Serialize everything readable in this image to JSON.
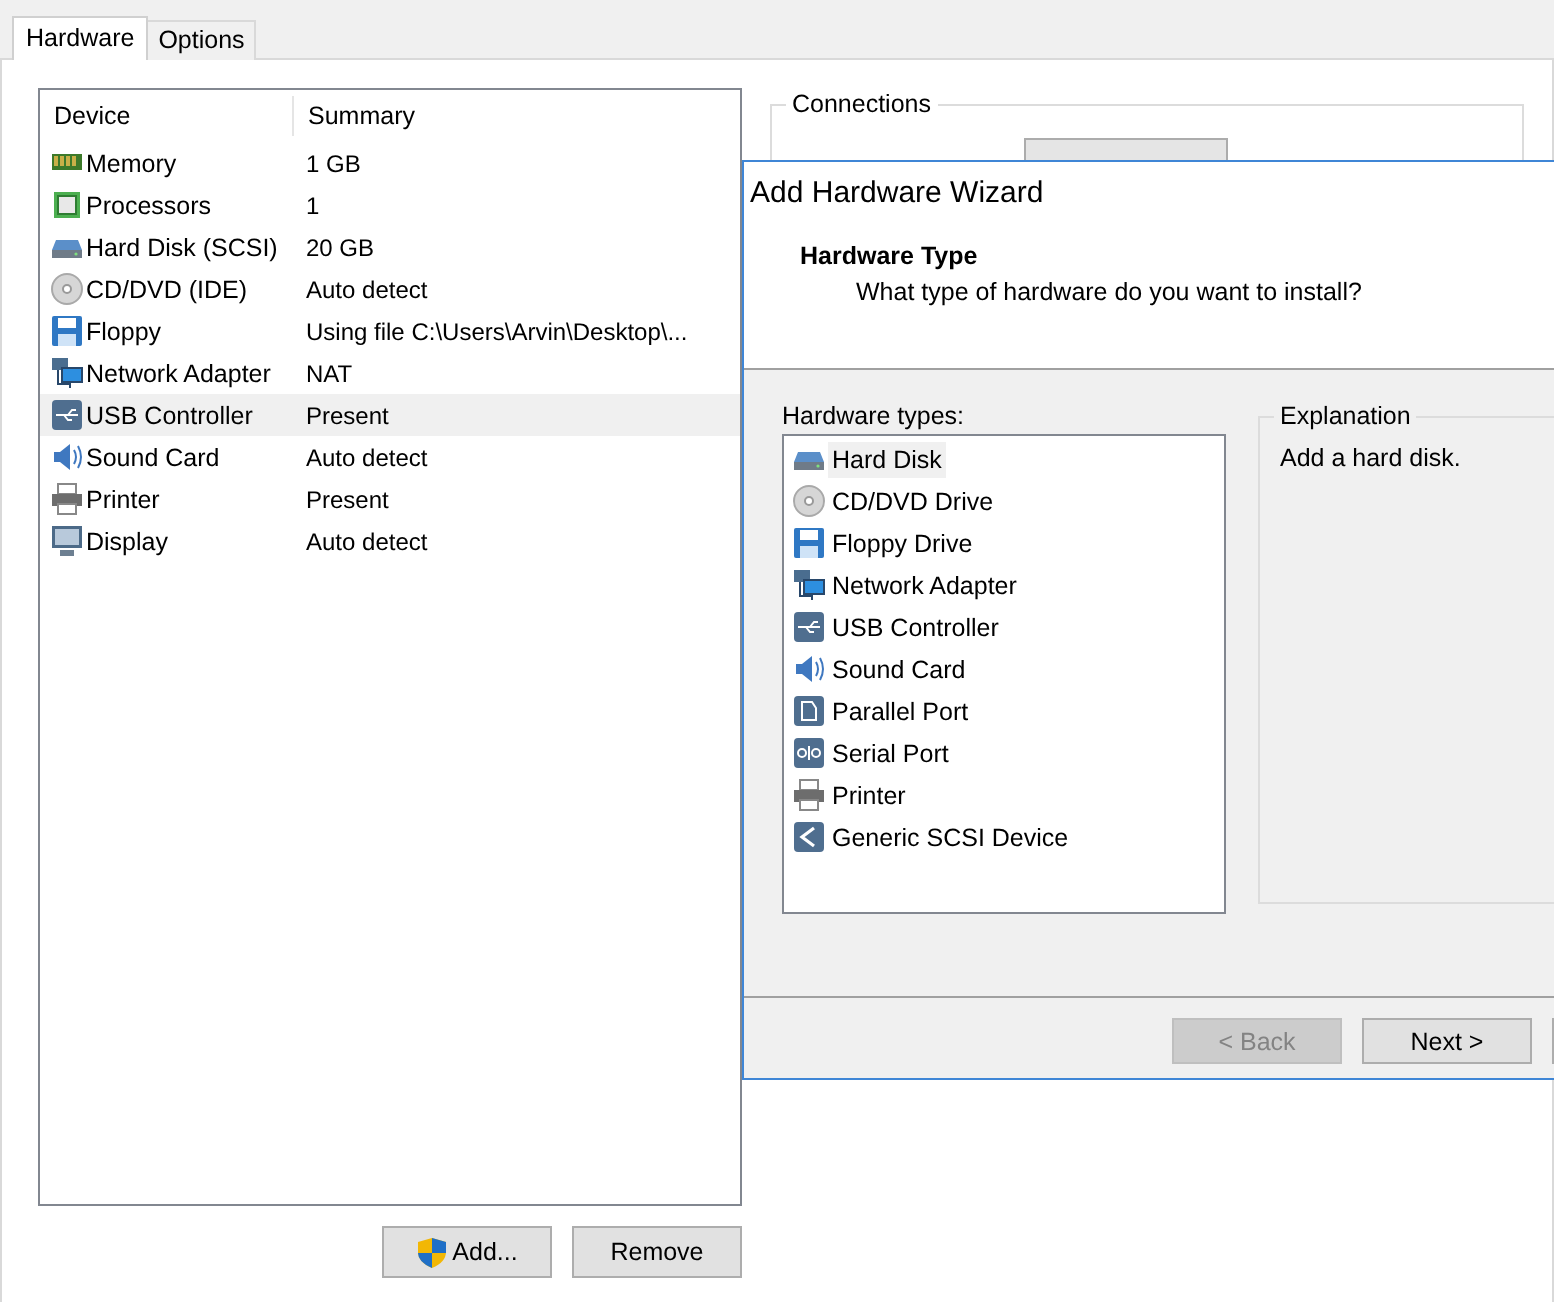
{
  "tabs": [
    {
      "label": "Hardware",
      "selected": true
    },
    {
      "label": "Options",
      "selected": false
    }
  ],
  "device_table": {
    "columns": [
      "Device",
      "Summary"
    ],
    "rows": [
      {
        "kind": "memory",
        "device": "Memory",
        "summary": "1 GB",
        "selected": false
      },
      {
        "kind": "processor",
        "device": "Processors",
        "summary": "1",
        "selected": false
      },
      {
        "kind": "harddisk",
        "device": "Hard Disk (SCSI)",
        "summary": "20 GB",
        "selected": false
      },
      {
        "kind": "cddvd",
        "device": "CD/DVD (IDE)",
        "summary": "Auto detect",
        "selected": false
      },
      {
        "kind": "floppy",
        "device": "Floppy",
        "summary": "Using file C:\\Users\\Arvin\\Desktop\\...",
        "selected": false
      },
      {
        "kind": "network",
        "device": "Network Adapter",
        "summary": "NAT",
        "selected": false
      },
      {
        "kind": "usb",
        "device": "USB Controller",
        "summary": "Present",
        "selected": true
      },
      {
        "kind": "sound",
        "device": "Sound Card",
        "summary": "Auto detect",
        "selected": false
      },
      {
        "kind": "printer",
        "device": "Printer",
        "summary": "Present",
        "selected": false
      },
      {
        "kind": "display",
        "device": "Display",
        "summary": "Auto detect",
        "selected": false
      }
    ]
  },
  "buttons": [
    {
      "label": "Add...",
      "shield": true
    },
    {
      "label": "Remove",
      "shield": false
    }
  ],
  "connections": {
    "title": "Connections"
  },
  "wizard": {
    "title": "Add Hardware Wizard",
    "heading": "Hardware Type",
    "subheading": "What type of hardware do you want to install?",
    "types_label": "Hardware types:",
    "types": [
      {
        "kind": "harddisk",
        "label": "Hard Disk",
        "selected": true
      },
      {
        "kind": "cddvd",
        "label": "CD/DVD Drive",
        "selected": false
      },
      {
        "kind": "floppy",
        "label": "Floppy Drive",
        "selected": false
      },
      {
        "kind": "network",
        "label": "Network Adapter",
        "selected": false
      },
      {
        "kind": "usb",
        "label": "USB Controller",
        "selected": false
      },
      {
        "kind": "sound",
        "label": "Sound Card",
        "selected": false
      },
      {
        "kind": "parallel",
        "label": "Parallel Port",
        "selected": false
      },
      {
        "kind": "serial",
        "label": "Serial Port",
        "selected": false
      },
      {
        "kind": "printer",
        "label": "Printer",
        "selected": false
      },
      {
        "kind": "scsi",
        "label": "Generic SCSI Device",
        "selected": false
      }
    ],
    "explanation_title": "Explanation",
    "explanation": "Add a hard disk.",
    "buttons": [
      {
        "label": "< Back",
        "disabled": true
      },
      {
        "label": "Next >",
        "disabled": false
      }
    ]
  }
}
